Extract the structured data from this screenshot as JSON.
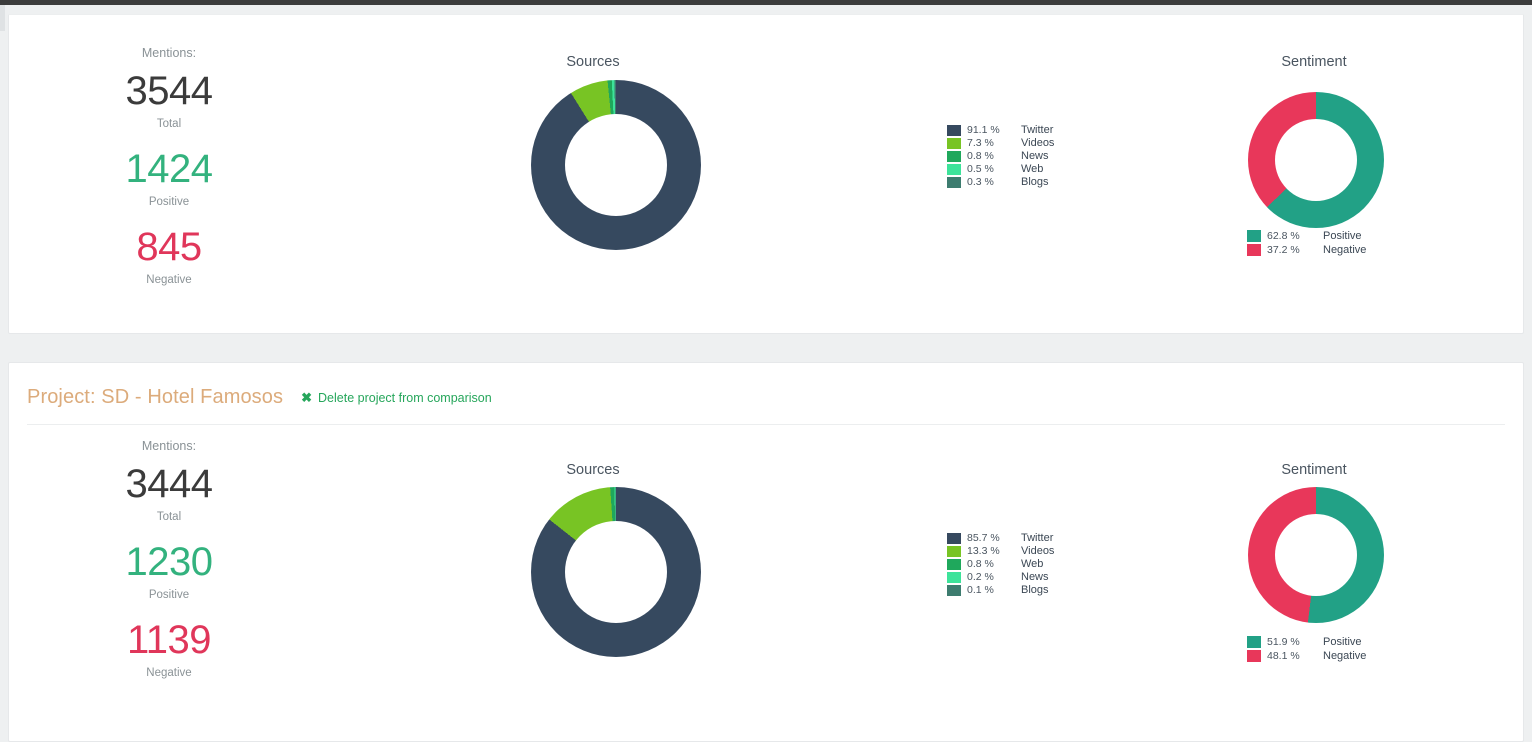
{
  "colors": {
    "twitter": "#36495F",
    "videos": "#78C424",
    "news": "#1FA85C",
    "web": "#3DE39A",
    "blogs": "#3D7C6F",
    "positive": "#22A186",
    "negative": "#E8375A",
    "title_orange": "#dcab7b",
    "link_green": "#26a65b",
    "total_number": "#3b3b3b",
    "positive_number": "#33b27e",
    "negative_number": "#e0365a"
  },
  "labels": {
    "mentions_caption": "Mentions:",
    "total": "Total",
    "positive": "Positive",
    "negative": "Negative",
    "sources_title": "Sources",
    "sentiment_title": "Sentiment"
  },
  "panels": [
    {
      "project_title": "",
      "delete_label": "",
      "delete_icon": "close-x-icon",
      "mentions": {
        "caption": "Mentions:",
        "total": "3544",
        "total_label": "Total",
        "positive": "1424",
        "positive_label": "Positive",
        "negative": "845",
        "negative_label": "Negative"
      },
      "sources": {
        "title": "Sources",
        "legend": [
          {
            "pct": "91.1 %",
            "name": "Twitter",
            "color": "#36495F"
          },
          {
            "pct": "7.3 %",
            "name": "Videos",
            "color": "#78C424"
          },
          {
            "pct": "0.8 %",
            "name": "News",
            "color": "#1FA85C"
          },
          {
            "pct": "0.5 %",
            "name": "Web",
            "color": "#3DE39A"
          },
          {
            "pct": "0.3 %",
            "name": "Blogs",
            "color": "#3D7C6F"
          }
        ]
      },
      "sentiment": {
        "title": "Sentiment",
        "legend": [
          {
            "pct": "62.8 %",
            "name": "Positive",
            "color": "#22A186"
          },
          {
            "pct": "37.2 %",
            "name": "Negative",
            "color": "#E8375A"
          }
        ]
      }
    },
    {
      "project_title": "Project: SD - Hotel Famosos",
      "delete_label": "Delete project from comparison",
      "delete_icon": "close-x-icon",
      "mentions": {
        "caption": "Mentions:",
        "total": "3444",
        "total_label": "Total",
        "positive": "1230",
        "positive_label": "Positive",
        "negative": "1139",
        "negative_label": "Negative"
      },
      "sources": {
        "title": "Sources",
        "legend": [
          {
            "pct": "85.7 %",
            "name": "Twitter",
            "color": "#36495F"
          },
          {
            "pct": "13.3 %",
            "name": "Videos",
            "color": "#78C424"
          },
          {
            "pct": "0.8 %",
            "name": "Web",
            "color": "#1FA85C"
          },
          {
            "pct": "0.2 %",
            "name": "News",
            "color": "#3DE39A"
          },
          {
            "pct": "0.1 %",
            "name": "Blogs",
            "color": "#3D7C6F"
          }
        ]
      },
      "sentiment": {
        "title": "Sentiment",
        "legend": [
          {
            "pct": "51.9 %",
            "name": "Positive",
            "color": "#22A186"
          },
          {
            "pct": "48.1 %",
            "name": "Negative",
            "color": "#E8375A"
          }
        ]
      }
    }
  ],
  "chart_data": [
    {
      "type": "pie",
      "title": "Sources",
      "panel": 1,
      "hole": 0.6,
      "start_angle": 0,
      "direction": "clockwise",
      "categories": [
        "Twitter",
        "Videos",
        "News",
        "Web",
        "Blogs"
      ],
      "values": [
        91.1,
        7.3,
        0.8,
        0.5,
        0.3
      ],
      "unit": "%",
      "colors": [
        "#36495F",
        "#78C424",
        "#1FA85C",
        "#3DE39A",
        "#3D7C6F"
      ],
      "legend_position": "right"
    },
    {
      "type": "pie",
      "title": "Sentiment",
      "panel": 1,
      "hole": 0.6,
      "start_angle": 0,
      "direction": "clockwise",
      "categories": [
        "Positive",
        "Negative"
      ],
      "values": [
        62.8,
        37.2
      ],
      "unit": "%",
      "colors": [
        "#22A186",
        "#E8375A"
      ],
      "legend_position": "bottom"
    },
    {
      "type": "pie",
      "title": "Sources",
      "panel": 2,
      "hole": 0.6,
      "start_angle": 0,
      "direction": "clockwise",
      "categories": [
        "Twitter",
        "Videos",
        "Web",
        "News",
        "Blogs"
      ],
      "values": [
        85.7,
        13.3,
        0.8,
        0.2,
        0.1
      ],
      "unit": "%",
      "colors": [
        "#36495F",
        "#78C424",
        "#1FA85C",
        "#3DE39A",
        "#3D7C6F"
      ],
      "legend_position": "right"
    },
    {
      "type": "pie",
      "title": "Sentiment",
      "panel": 2,
      "hole": 0.6,
      "start_angle": 0,
      "direction": "clockwise",
      "categories": [
        "Positive",
        "Negative"
      ],
      "values": [
        51.9,
        48.1
      ],
      "unit": "%",
      "colors": [
        "#22A186",
        "#E8375A"
      ],
      "legend_position": "bottom"
    }
  ]
}
